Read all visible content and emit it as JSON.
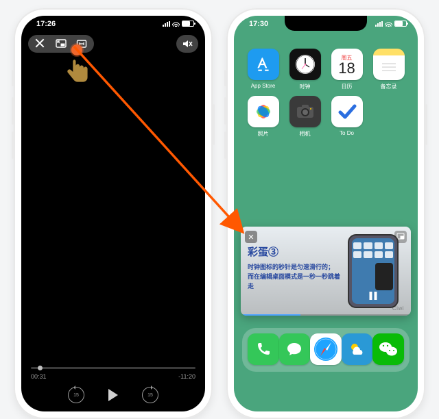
{
  "left": {
    "status_time": "17:26",
    "controls": {
      "close": "close",
      "pip": "picture-in-picture",
      "aspect": "aspect-fit",
      "mute": "mute"
    },
    "player": {
      "elapsed": "00:31",
      "remaining": "-11:20",
      "skip_back": "15",
      "skip_fwd": "15"
    }
  },
  "right": {
    "status_time": "17:30",
    "apps_row1": [
      {
        "name": "App Store",
        "bg": "#1e9bf0"
      },
      {
        "name": "时钟",
        "bg": "#111"
      },
      {
        "name": "日历",
        "bg": "#fff",
        "weekday": "周五",
        "day": "18"
      },
      {
        "name": "备忘录",
        "bg": "#fff"
      }
    ],
    "apps_row2": [
      {
        "name": "照片",
        "bg": "#fff"
      },
      {
        "name": "相机",
        "bg": "#3a3a3a"
      },
      {
        "name": "To Do",
        "bg": "#fff"
      }
    ],
    "pip": {
      "title": "彩蛋③",
      "line1": "时钟图标的秒针是匀速滑行的；",
      "line2": "而在编辑桌面模式是一秒一秒跳着走",
      "brand": "Ciwi"
    },
    "dock": [
      "phone",
      "messages",
      "safari",
      "weather",
      "wechat"
    ]
  }
}
